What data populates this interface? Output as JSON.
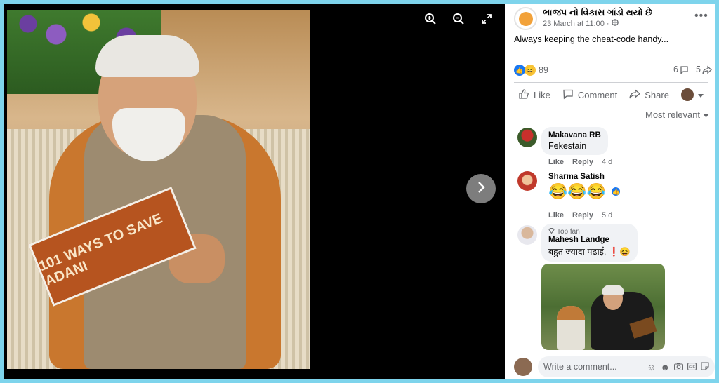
{
  "viewer": {
    "zoom_in_icon": "zoom-in-icon",
    "zoom_out_icon": "zoom-out-icon",
    "fullscreen_icon": "fullscreen-icon",
    "next_icon": "chevron-right-icon",
    "photo_book_text": "101 WAYS TO SAVE ADANI"
  },
  "post": {
    "page_name": "ભાજપ નો વિકાસ ગાંડો થયો છે",
    "time": "23 March at 11:00 ·",
    "caption": "Always keeping the cheat-code handy...",
    "reaction_count": "89",
    "comment_count": "6",
    "share_count": "5"
  },
  "actions": {
    "like": "Like",
    "comment": "Comment",
    "share": "Share"
  },
  "sort_label": "Most relevant",
  "comments": [
    {
      "name": "Makavana RB",
      "text": "Fekestain",
      "like": "Like",
      "reply": "Reply",
      "time": "4 d"
    },
    {
      "name": "Sharma Satish",
      "text": "😂😂😂",
      "like": "Like",
      "reply": "Reply",
      "time": "5 d"
    },
    {
      "badge": "Top fan",
      "name": "Mahesh Landge",
      "text": "बहुत ज्यादा पढाई, ❗😆"
    }
  ],
  "composer": {
    "placeholder": "Write a comment..."
  },
  "colors": {
    "accent": "#1877f2",
    "frame": "#7ed4ec",
    "bubble": "#f0f2f5",
    "secondary_text": "#65676b"
  }
}
